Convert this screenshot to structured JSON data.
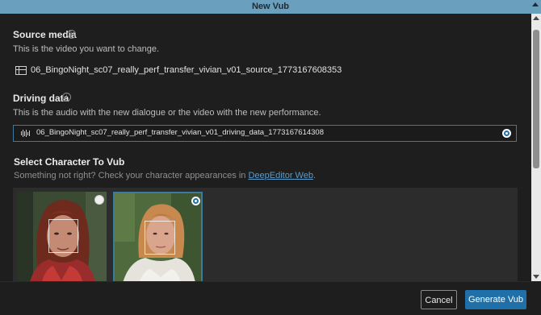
{
  "window": {
    "title": "New Vub"
  },
  "source_media": {
    "title": "Source media",
    "description": "This is the video you want to change.",
    "file_name": "06_BingoNight_sc07_really_perf_transfer_vivian_v01_source_1773167608353"
  },
  "driving_data": {
    "title": "Driving data",
    "description": "This is the audio with the new dialogue or the video with the new performance.",
    "file_name": "06_BingoNight_sc07_really_perf_transfer_vivian_v01_driving_data_1773167614308",
    "selected": true
  },
  "select_character": {
    "title": "Select Character To Vub",
    "hint_prefix": "Something not right? Check your character appearances in ",
    "hint_link": "DeepEditor Web",
    "hint_suffix": ".",
    "characters": [
      {
        "selected": false
      },
      {
        "selected": true
      }
    ]
  },
  "footer": {
    "cancel_label": "Cancel",
    "generate_label": "Generate Vub"
  },
  "colors": {
    "accent": "#1f6fa8",
    "title_bar": "#6a9fbd",
    "link": "#5b9ccc"
  }
}
